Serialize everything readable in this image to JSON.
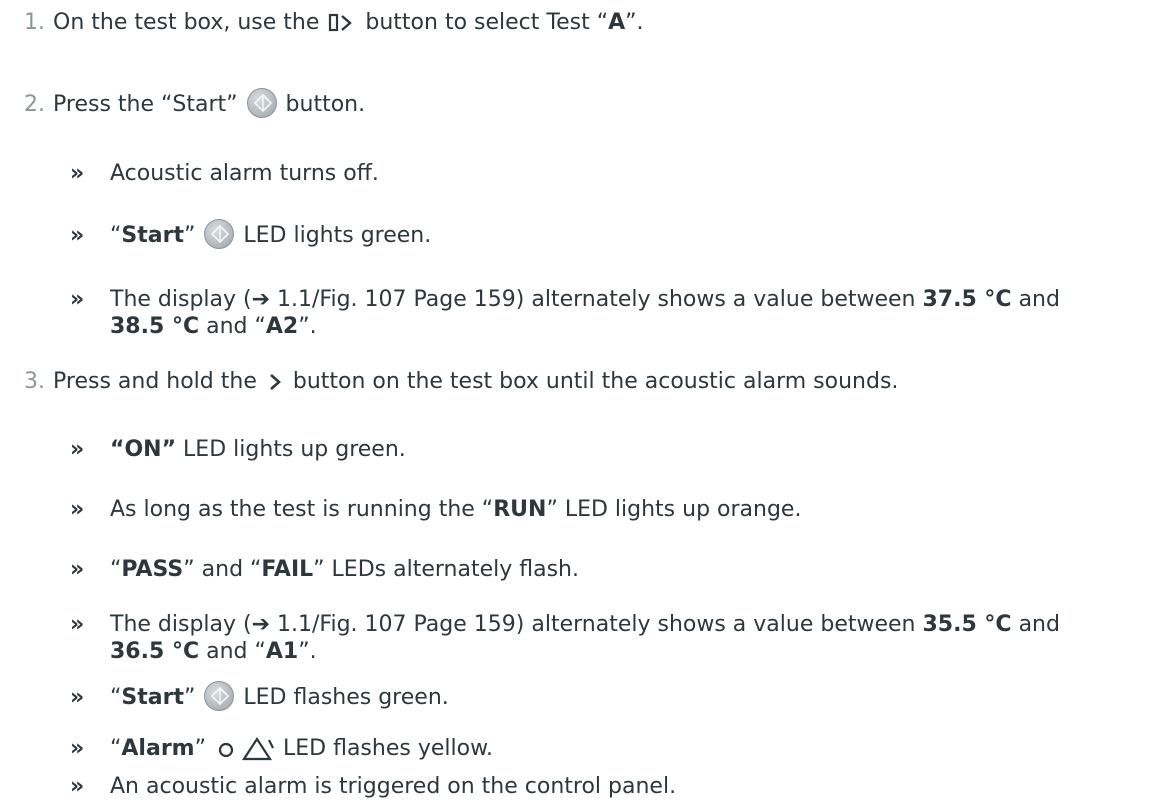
{
  "steps": [
    {
      "num": "1.",
      "pre": "On the test box, use the",
      "post": "button to select Test “",
      "bold": "A",
      "end": "”."
    },
    {
      "num": "2.",
      "pre": "Press the “Start”",
      "post": "button."
    },
    {
      "num": "3.",
      "pre": "Press and hold the",
      "post": "button on the test box until the acoustic alarm sounds."
    }
  ],
  "results": {
    "r1": {
      "bullet": "»",
      "text": "Acoustic alarm turns off."
    },
    "r2": {
      "bullet": "»",
      "q1": "“",
      "bold": "Start",
      "q2": "”",
      "post": "LED lights green."
    },
    "r3": {
      "bullet": "»",
      "t1": "The display (➔ 1.1/Fig. 107 Page 159) alternately shows a value between ",
      "b1": "37.5 °C",
      "t2": " and ",
      "b2": "38.5 °C",
      "t3": " and “",
      "b3": "A2",
      "t4": "”."
    },
    "r4": {
      "bullet": "»",
      "bold": "“ON”",
      "post": " LED lights up green."
    },
    "r5": {
      "bullet": "»",
      "pre": "As long as the test is running the “",
      "bold": "RUN",
      "post": "” LED lights up orange."
    },
    "r6": {
      "bullet": "»",
      "q1": "“",
      "b1": "PASS",
      "mid": "” and “",
      "b2": "FAIL",
      "post": "” LEDs alternately flash."
    },
    "r7": {
      "bullet": "»",
      "t1": "The display (➔ 1.1/Fig. 107 Page 159) alternately shows a value between ",
      "b1": "35.5 °C",
      "t2": " and ",
      "b2": "36.5 °C",
      "t3": " and “",
      "b3": "A1",
      "t4": "”."
    },
    "r8": {
      "bullet": "»",
      "q1": "“",
      "bold": "Start",
      "q2": "”",
      "post": "LED flashes green."
    },
    "r9": {
      "bullet": "»",
      "q1": "“",
      "bold": "Alarm",
      "q2": "”",
      "post": "LED flashes yellow."
    },
    "r10": {
      "bullet": "»",
      "text": "An acoustic alarm is triggered on the control panel."
    }
  },
  "icons": {
    "select_test": "select-test-button-icon",
    "start": "start-button-icon",
    "next": "chevron-right-icon",
    "alarm_circle": "circle-icon",
    "alarm_triangle": "warning-triangle-icon"
  }
}
